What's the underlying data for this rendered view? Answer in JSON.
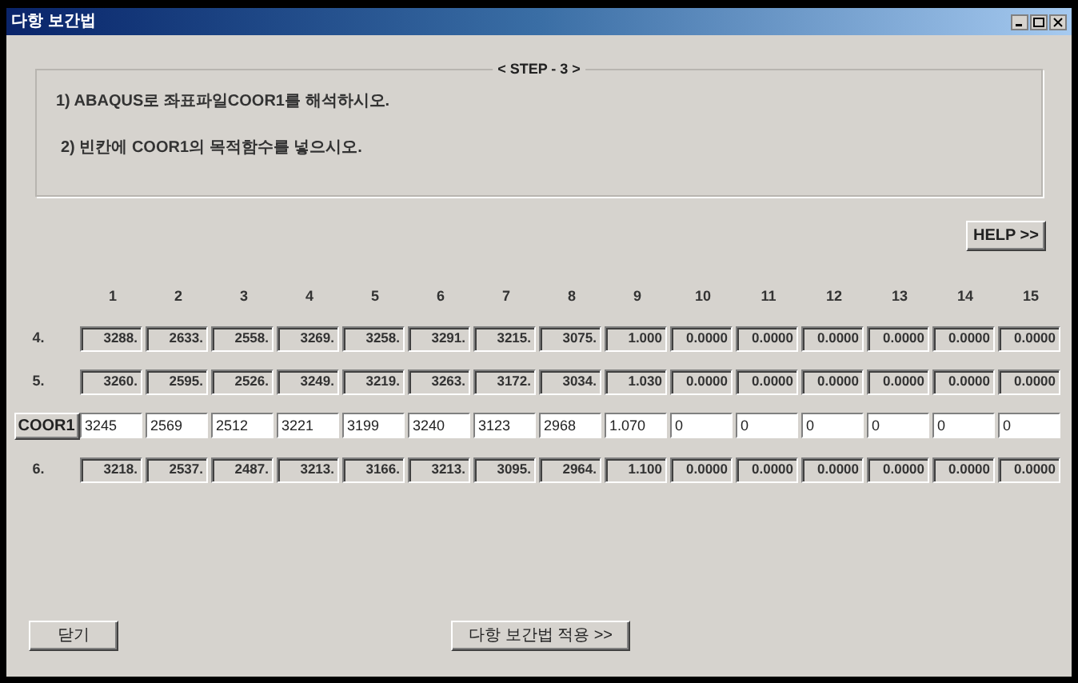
{
  "window": {
    "title": "다항 보간법"
  },
  "step_group": {
    "title": "< STEP - 3 >",
    "instructions": [
      "1) ABAQUS로 좌표파일COOR1를 해석하시오.",
      "2) 빈칸에 COOR1의 목적함수를 넣으시오."
    ]
  },
  "help_button": "HELP >>",
  "table": {
    "columns": [
      "1",
      "2",
      "3",
      "4",
      "5",
      "6",
      "7",
      "8",
      "9",
      "10",
      "11",
      "12",
      "13",
      "14",
      "15"
    ],
    "rows": [
      {
        "label": "4.",
        "kind": "readonly",
        "values": [
          "3288.",
          "2633.",
          "2558.",
          "3269.",
          "3258.",
          "3291.",
          "3215.",
          "3075.",
          "1.000",
          "0.0000",
          "0.0000",
          "0.0000",
          "0.0000",
          "0.0000",
          "0.0000"
        ]
      },
      {
        "label": "5.",
        "kind": "readonly",
        "values": [
          "3260.",
          "2595.",
          "2526.",
          "3249.",
          "3219.",
          "3263.",
          "3172.",
          "3034.",
          "1.030",
          "0.0000",
          "0.0000",
          "0.0000",
          "0.0000",
          "0.0000",
          "0.0000"
        ]
      },
      {
        "label": "COOR1",
        "kind": "input",
        "values": [
          "3245",
          "2569",
          "2512",
          "3221",
          "3199",
          "3240",
          "3123",
          "2968",
          "1.070",
          "0",
          "0",
          "0",
          "0",
          "0",
          "0"
        ]
      },
      {
        "label": "6.",
        "kind": "readonly",
        "values": [
          "3218.",
          "2537.",
          "2487.",
          "3213.",
          "3166.",
          "3213.",
          "3095.",
          "2964.",
          "1.100",
          "0.0000",
          "0.0000",
          "0.0000",
          "0.0000",
          "0.0000",
          "0.0000"
        ]
      }
    ]
  },
  "buttons": {
    "close": "닫기",
    "apply": "다항 보간법 적용 >>"
  }
}
